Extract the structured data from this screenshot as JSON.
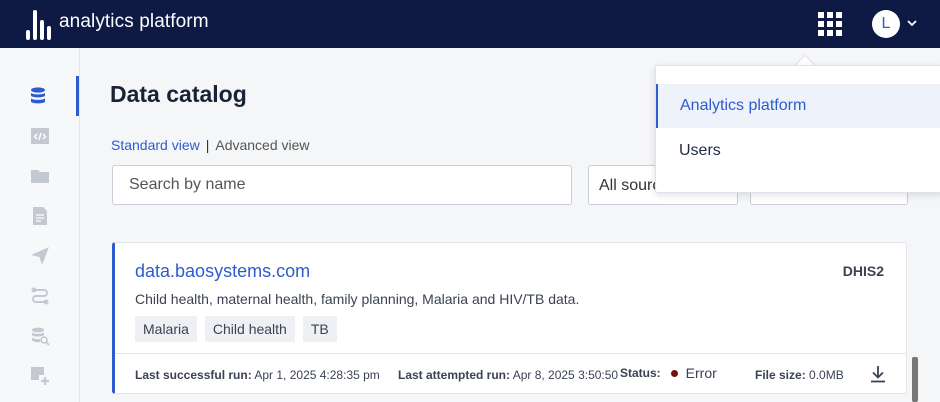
{
  "header": {
    "brand": "analytics platform",
    "apps_icon": "grid-icon",
    "avatar_initial": "L",
    "avatar_caret_icon": "chevron-down-icon"
  },
  "sidebar": {
    "items": [
      {
        "icon": "database-icon",
        "active": true
      },
      {
        "icon": "code-window-icon",
        "active": false
      },
      {
        "icon": "folder-icon",
        "active": false
      },
      {
        "icon": "document-icon",
        "active": false
      },
      {
        "icon": "send-icon",
        "active": false
      },
      {
        "icon": "workflow-icon",
        "active": false
      },
      {
        "icon": "database-search-icon",
        "active": false
      },
      {
        "icon": "add-item-icon",
        "active": false
      }
    ]
  },
  "main": {
    "title": "Data catalog",
    "view_toggle": {
      "standard": "Standard view",
      "separator": "|",
      "advanced": "Advanced view"
    },
    "search_placeholder": "Search by name",
    "source_filter_value": "All sources"
  },
  "card": {
    "title": "data.baosystems.com",
    "type": "DHIS2",
    "description": "Child health, maternal health, family planning, Malaria and HIV/TB data.",
    "tags": [
      "Malaria",
      "Child health",
      "TB"
    ],
    "footer": {
      "last_success_label": "Last successful run:",
      "last_success_value": "Apr 1, 2025 4:28:35 pm",
      "last_attempt_label": "Last attempted run:",
      "last_attempt_value": "Apr 8, 2025 3:50:50",
      "status_label": "Status:",
      "status_value": "Error",
      "status_color": "#7a0f12",
      "file_size_label": "File size:",
      "file_size_value": "0.0MB",
      "download_icon": "download-icon"
    }
  },
  "app_menu": {
    "items": [
      {
        "label": "Analytics platform",
        "selected": true
      },
      {
        "label": "Users",
        "selected": false
      }
    ]
  },
  "colors": {
    "accent": "#2f5bd1",
    "header_bg": "#0f1a44"
  }
}
